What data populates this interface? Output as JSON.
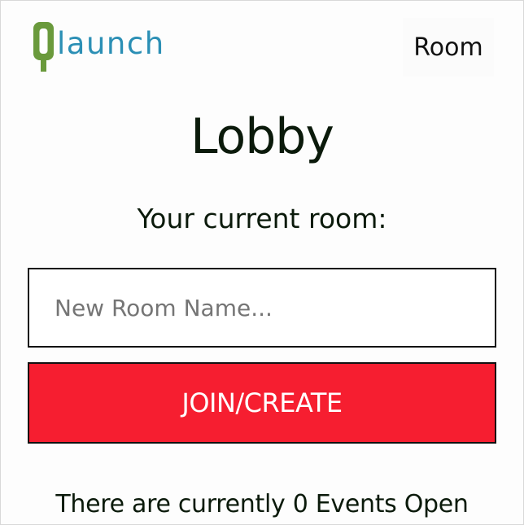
{
  "header": {
    "logo": {
      "letter": "Q",
      "word": "launch",
      "letter_color": "#6a9a3c",
      "word_color": "#2b8fb5"
    },
    "nav_room_label": "Room"
  },
  "main": {
    "title": "Lobby",
    "current_room_label": "Your current room:",
    "room_input": {
      "value": "",
      "placeholder": "New Room Name..."
    },
    "join_button_label": "JOIN/CREATE",
    "events_status": "There are currently 0 Events Open"
  },
  "colors": {
    "accent_button": "#f61e30",
    "text": "#0b1a0b"
  }
}
